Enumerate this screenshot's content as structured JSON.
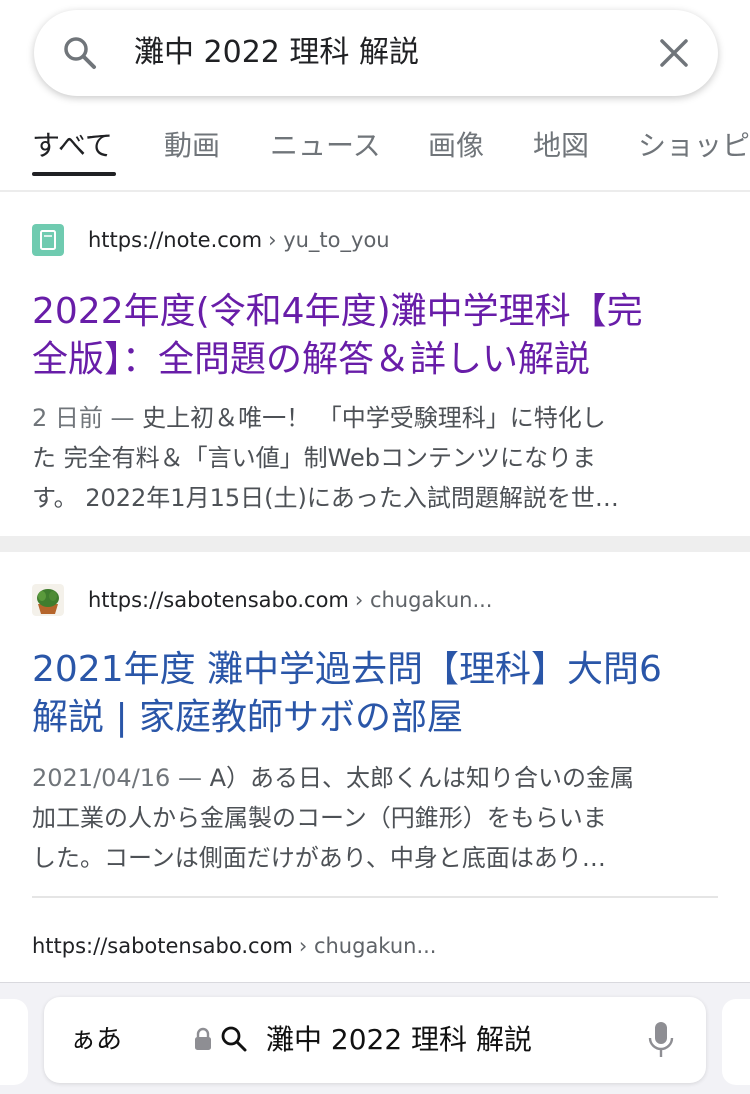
{
  "search": {
    "query": "灘中 2022 理科 解説"
  },
  "tabs": [
    {
      "label": "すべて",
      "active": true
    },
    {
      "label": "動画"
    },
    {
      "label": "ニュース"
    },
    {
      "label": "画像"
    },
    {
      "label": "地図"
    },
    {
      "label": "ショッピ"
    }
  ],
  "results": [
    {
      "url": "https://note.com",
      "path": "› yu_to_you",
      "title_line1": "2022年度(令和4年度)灘中学理科【完",
      "title_line2": "全版】：全問題の解答＆詳しい解説",
      "snippet_date": "2 日前 — ",
      "snippet_line1": "史上初＆唯一！ 「中学受験理科」に特化し",
      "snippet_line2": "た 完全有料＆「言い値」制Webコンテンツになりま",
      "snippet_line3": "す。 2022年1月15日(土)にあった入試問題解説を世…",
      "favicon": "note-icon",
      "favicon_color": "#6fcbb0"
    },
    {
      "url": "https://sabotensabo.com",
      "path": "› chugakun...",
      "title_line1": "2021年度 灘中学過去問【理科】大問6",
      "title_line2": "解説 | 家庭教師サボの部屋",
      "snippet_date": "2021/04/16 — ",
      "snippet_line1": "A）ある日、太郎くんは知り合いの金属",
      "snippet_line2": "加工業の人から金属製のコーン（円錐形）をもらいま",
      "snippet_line3": "した。コーンは側面だけがあり、中身と底面はあり…",
      "favicon": "cactus-icon"
    },
    {
      "url": "https://sabotensabo.com",
      "path": "› chugakun..."
    }
  ],
  "browser": {
    "aa_label": "ぁあ",
    "address_text": "灘中 2022 理科 解説"
  },
  "colors": {
    "visited_link": "#681da8",
    "link": "#2a56a8",
    "accent_tab": "#202124"
  }
}
